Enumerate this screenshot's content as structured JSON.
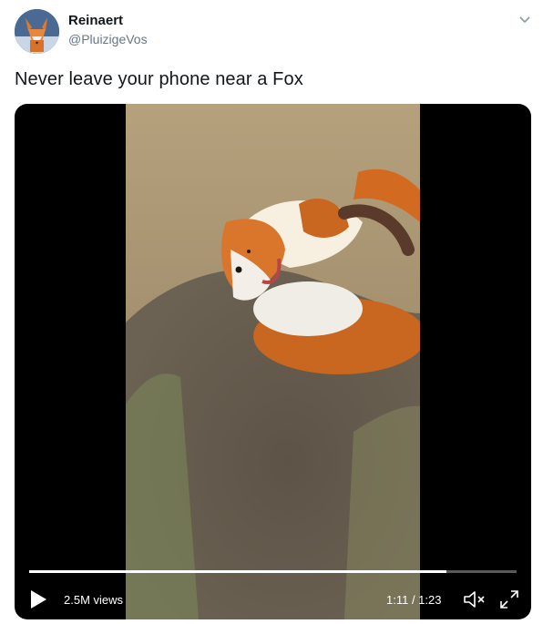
{
  "tweet": {
    "display_name": "Reinaert",
    "handle": "@PluizigeVos",
    "text": "Never leave your phone near a Fox",
    "menu_icon": "chevron-down-icon"
  },
  "video": {
    "views": "2.5M views",
    "time": "1:11 / 1:23",
    "progress": 0.857,
    "icons": [
      "play-icon",
      "mute-icon",
      "fullscreen-icon"
    ]
  },
  "colors": {
    "name": "#14171a",
    "handle": "#657786",
    "media_bg": "#000000"
  }
}
